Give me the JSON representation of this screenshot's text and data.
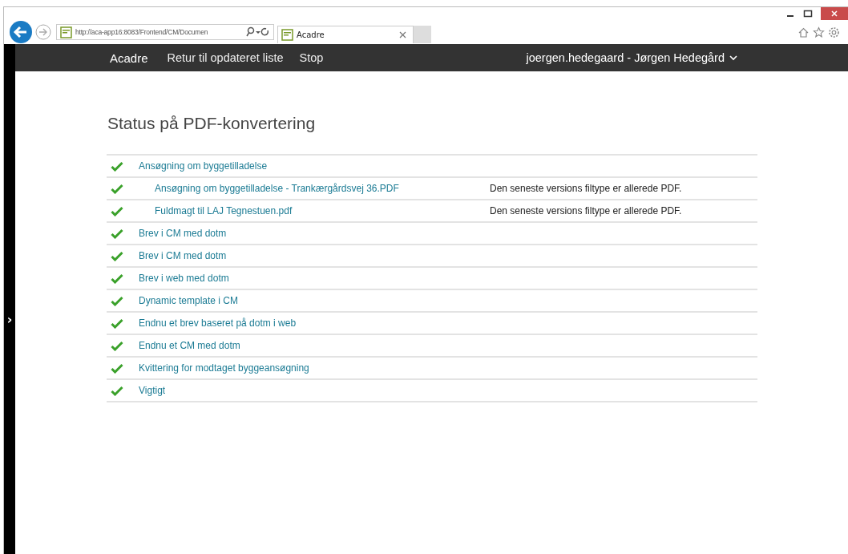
{
  "browser": {
    "address": "http://aca-app16:8083/Frontend/CM/Documen",
    "tab_title": "Acadre"
  },
  "nav": {
    "brand": "Acadre",
    "links": [
      "Retur til opdateret liste",
      "Stop"
    ],
    "user": "joergen.hedegaard - Jørgen Hedegård"
  },
  "sidebar": {
    "toggle": "›"
  },
  "title": "Status på PDF-konvertering",
  "items": [
    {
      "name": "Ansøgning om byggetilladelse",
      "converted": true,
      "children": [
        {
          "name": "Ansøgning om byggetilladelse - Trankærgårdsvej 36.PDF",
          "converted": true,
          "message": "Den seneste versions filtype er allerede PDF."
        },
        {
          "name": "Fuldmagt til LAJ Tegnestuen.pdf",
          "converted": true,
          "message": "Den seneste versions filtype er allerede PDF."
        }
      ]
    },
    {
      "name": "Brev i CM med dotm",
      "converted": true
    },
    {
      "name": "Brev i CM med dotm",
      "converted": true
    },
    {
      "name": "Brev i web med dotm",
      "converted": true
    },
    {
      "name": "Dynamic template i CM",
      "converted": true
    },
    {
      "name": "Endnu et brev baseret på dotm i web",
      "converted": true
    },
    {
      "name": "Endnu et CM med dotm",
      "converted": true
    },
    {
      "name": "Kvittering for modtaget byggeansøgning",
      "converted": true
    },
    {
      "name": "Vigtigt",
      "converted": true
    }
  ]
}
